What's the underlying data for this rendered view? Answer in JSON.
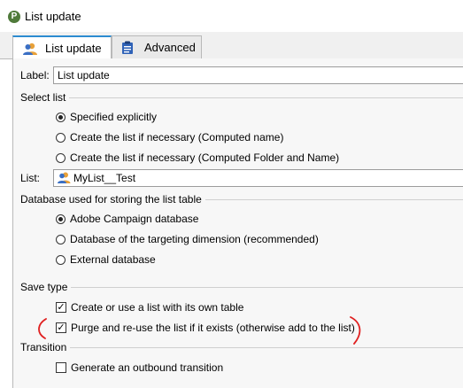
{
  "window": {
    "title": "List update",
    "icon": "app-logo-icon"
  },
  "tabs": [
    {
      "label": "List update",
      "icon": "users-icon",
      "active": true
    },
    {
      "label": "Advanced",
      "icon": "clipboard-icon",
      "active": false
    }
  ],
  "form": {
    "label_caption": "Label:",
    "label_value": "List update",
    "select_list_title": "Select list",
    "select_list_options": [
      {
        "label": "Specified explicitly",
        "checked": true
      },
      {
        "label": "Create the list if necessary (Computed name)",
        "checked": false
      },
      {
        "label": "Create the list if necessary (Computed Folder and Name)",
        "checked": false
      }
    ],
    "list_caption": "List:",
    "list_value": "MyList__Test",
    "list_icon": "list-users-icon",
    "database_title": "Database used for storing the list table",
    "database_options": [
      {
        "label": "Adobe Campaign database",
        "checked": true
      },
      {
        "label": "Database of the targeting dimension (recommended)",
        "checked": false
      },
      {
        "label": "External database",
        "checked": false
      }
    ],
    "save_type_title": "Save type",
    "save_type_options": [
      {
        "label": "Create or use a list with its own table",
        "checked": true
      },
      {
        "label": "Purge and re-use the list if it exists (otherwise add to the list)",
        "checked": true
      }
    ],
    "transition_title": "Transition",
    "transition_options": [
      {
        "label": "Generate an outbound transition",
        "checked": false
      }
    ]
  },
  "annotation": {
    "color": "#e02020",
    "shape": "red-hand-drawn-brackets"
  }
}
